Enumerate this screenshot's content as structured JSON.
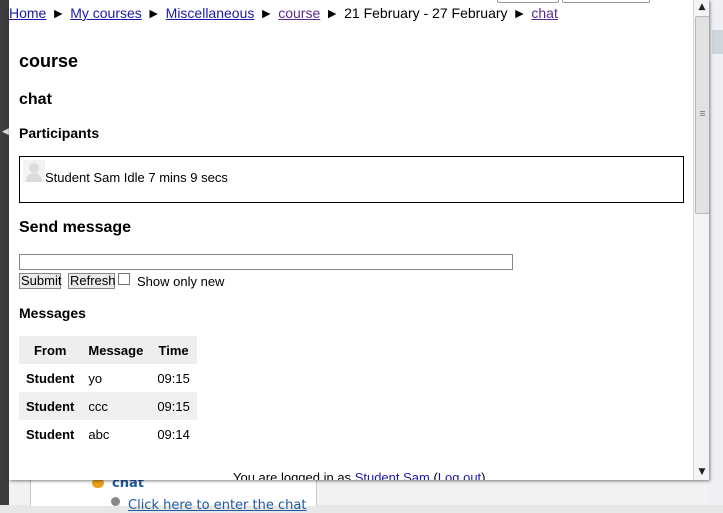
{
  "breadcrumb": {
    "items": [
      {
        "label": "Home",
        "visited": false
      },
      {
        "label": "My courses",
        "visited": false
      },
      {
        "label": "Miscellaneous",
        "visited": false
      },
      {
        "label": "course",
        "visited": true
      },
      {
        "label": "21 February - 27 February",
        "link": false
      },
      {
        "label": "chat",
        "visited": true
      }
    ],
    "separator": "►"
  },
  "headings": {
    "course": "course",
    "chat": "chat",
    "participants": "Participants",
    "send_message": "Send message",
    "messages": "Messages"
  },
  "participants": [
    {
      "name": "Student Sam",
      "status": "Idle 7 mins 9 secs",
      "avatar_icon": "user-avatar-icon"
    }
  ],
  "send": {
    "input_value": "",
    "submit_label": "Submit",
    "refresh_label": "Refresh",
    "show_only_new_label": "Show only new",
    "show_only_new_checked": false
  },
  "messages_table": {
    "headers": [
      "From",
      "Message",
      "Time"
    ],
    "rows": [
      {
        "from": "Student",
        "message": "yo",
        "time": "09:15"
      },
      {
        "from": "Student",
        "message": "ccc",
        "time": "09:15"
      },
      {
        "from": "Student",
        "message": "abc",
        "time": "09:14"
      }
    ]
  },
  "footer": {
    "prefix": "You are logged in as",
    "user": "Student Sam",
    "logout": "Log out"
  },
  "background": {
    "chat_label": "chat",
    "enter_link": "Click here to enter the chat"
  },
  "colors": {
    "link": "#1a1aa8",
    "visited": "#5a2a8a",
    "table_header": "#eeeeee",
    "table_alt_row": "#f0f0f0"
  }
}
